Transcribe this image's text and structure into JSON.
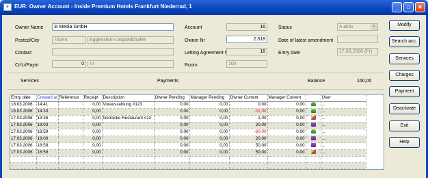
{
  "window": {
    "title": "EUR: Owner Account - Inside Premium Hotels Frankfurt Niederrad, 1",
    "app_icon": "app-window-icon",
    "controls": [
      "minimize",
      "maximize",
      "close"
    ]
  },
  "form": {
    "owner_name_label": "Owner Name",
    "owner_name_value": "3i Media GmbH",
    "postcd_city_label": "Postcd/City",
    "postcode_value": "76344",
    "city_value": "Eggenstein-Leopoldshafen",
    "contact_label": "Contact",
    "contact_value": "",
    "cr_li_paym_label": "Cr/Li/Paym",
    "cr_li_paym_value": "0",
    "cr_li_paym_code": "VI",
    "account_label": "Account",
    "account_value": "16",
    "owner_nr_label": "Owner Nr",
    "owner_nr_value": "2.318",
    "letting_label": "Letting Agreement N",
    "letting_value": "16",
    "room_label": "Room",
    "room_value": "103",
    "status_label": "Status",
    "status_value": "A aktiv",
    "latest_amendment_label": "Date of latest amendment",
    "latest_amendment_value": "",
    "entry_date_label": "Entry date",
    "entry_date_value": "17.03.2006 (Fr)"
  },
  "summary": {
    "services_label": "Services",
    "payments_label": "Payments",
    "balance_label": "Balance",
    "balance_value": "160,00"
  },
  "grid": {
    "columns": [
      "Entry date",
      "Created at",
      "Reference",
      "Receipt",
      "Description",
      "Owner Pending",
      "Manager Pending",
      "Owner Current",
      "Manager Current",
      "",
      "User"
    ],
    "rows": [
      {
        "date": "18.03.2006",
        "time": "14:41",
        "ref": "",
        "receipt": "0,00",
        "desc": "Vorauszahlung   #123",
        "op": "0,00",
        "mp": "0,00",
        "oc": "0,00",
        "mc": "0,00",
        "icon": "plant-icon",
        "user": "..."
      },
      {
        "date": "18.03.2006",
        "time": "14:30",
        "ref": "",
        "receipt": "0,00",
        "desc": "",
        "op": "0,00",
        "mp": "0,00",
        "oc": "-11,00",
        "mc": "0,00",
        "icon": "plant-icon",
        "user": "..."
      },
      {
        "date": "17.03.2006",
        "time": "19:36",
        "ref": "",
        "receipt": "0,00",
        "desc": "Getränke Restaurant #12",
        "op": "0,00",
        "mp": "0,00",
        "oc": "1,00",
        "mc": "0,00",
        "icon": "pencil-icon",
        "user": "..."
      },
      {
        "date": "17.03.2006",
        "time": "19:03",
        "ref": "",
        "receipt": "0,00",
        "desc": "",
        "op": "0,00",
        "mp": "0,00",
        "oc": "20,00",
        "mc": "0,00",
        "icon": "bottle-icon",
        "user": "..."
      },
      {
        "date": "17.03.2006",
        "time": "18:59",
        "ref": "",
        "receipt": "0,00",
        "desc": "",
        "op": "0,00",
        "mp": "0,00",
        "oc": "-60,00",
        "mc": "0,00",
        "icon": "plant-icon",
        "user": "..."
      },
      {
        "date": "17.03.2006",
        "time": "19:00",
        "ref": "",
        "receipt": "0,00",
        "desc": "",
        "op": "0,00",
        "mp": "0,00",
        "oc": "20,00",
        "mc": "0,00",
        "icon": "bottle-icon",
        "user": "..."
      },
      {
        "date": "17.03.2006",
        "time": "18:59",
        "ref": "",
        "receipt": "0,00",
        "desc": "",
        "op": "0,00",
        "mp": "0,00",
        "oc": "50,00",
        "mc": "0,00",
        "icon": "bottle-icon",
        "user": "..."
      },
      {
        "date": "17.03.2006",
        "time": "18:59",
        "ref": "",
        "receipt": "0,00",
        "desc": "",
        "op": "0,00",
        "mp": "0,00",
        "oc": "50,00",
        "mc": "0,00",
        "icon": "pencil-icon",
        "user": "..."
      }
    ]
  },
  "buttons": [
    "Modify",
    "Search acc.",
    "Services",
    "Charges",
    "Payment",
    "Deactivate",
    "Exit",
    "Help"
  ],
  "colors": {
    "titlebar": "#0a47c2",
    "negative": "#e01010",
    "selected_header": "#2442c8"
  }
}
